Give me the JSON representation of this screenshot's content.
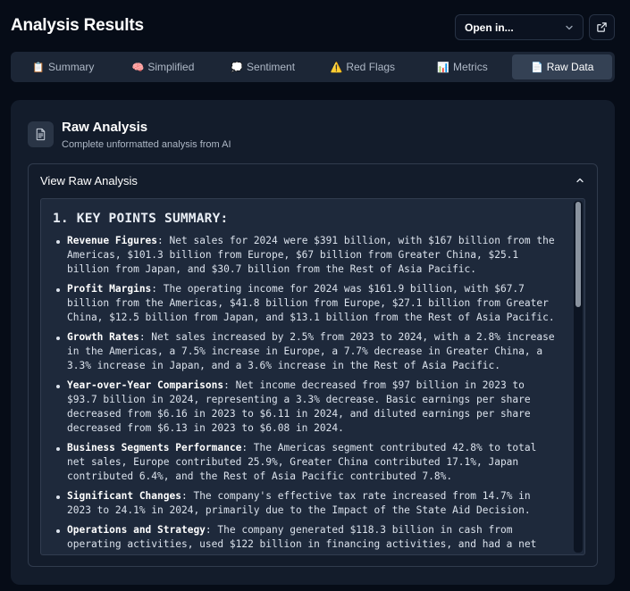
{
  "header": {
    "title": "Analysis Results",
    "open_in_label": "Open in...",
    "open_in_icon": "chevron-down-icon",
    "external_icon": "external-link-icon"
  },
  "tabs": [
    {
      "emoji": "📋",
      "label": "Summary",
      "active": false
    },
    {
      "emoji": "🧠",
      "label": "Simplified",
      "active": false
    },
    {
      "emoji": "💭",
      "label": "Sentiment",
      "active": false
    },
    {
      "emoji": "⚠️",
      "label": "Red Flags",
      "active": false
    },
    {
      "emoji": "📊",
      "label": "Metrics",
      "active": false
    },
    {
      "emoji": "📄",
      "label": "Raw Data",
      "active": true
    }
  ],
  "panel": {
    "icon": "document-icon",
    "title": "Raw Analysis",
    "subtitle": "Complete unformatted analysis from AI"
  },
  "accordion": {
    "label": "View Raw Analysis",
    "expanded": true
  },
  "raw": {
    "heading": "1. KEY POINTS SUMMARY:",
    "items": [
      {
        "term": "Revenue Figures",
        "text": ": Net sales for 2024 were $391 billion, with $167 billion from the Americas, $101.3 billion from Europe, $67 billion from Greater China, $25.1 billion from Japan, and $30.7 billion from the Rest of Asia Pacific."
      },
      {
        "term": "Profit Margins",
        "text": ": The operating income for 2024 was $161.9 billion, with $67.7 billion from the Americas, $41.8 billion from Europe, $27.1 billion from Greater China, $12.5 billion from Japan, and $13.1 billion from the Rest of Asia Pacific."
      },
      {
        "term": "Growth Rates",
        "text": ": Net sales increased by 2.5% from 2023 to 2024, with a 2.8% increase in the Americas, a 7.5% increase in Europe, a 7.7% decrease in Greater China, a 3.3% increase in Japan, and a 3.6% increase in the Rest of Asia Pacific."
      },
      {
        "term": "Year-over-Year Comparisons",
        "text": ": Net income decreased from $97 billion in 2023 to $93.7 billion in 2024, representing a 3.3% decrease. Basic earnings per share decreased from $6.16 in 2023 to $6.11 in 2024, and diluted earnings per share decreased from $6.13 in 2023 to $6.08 in 2024."
      },
      {
        "term": "Business Segments Performance",
        "text": ": The Americas segment contributed 42.8% to total net sales, Europe contributed 25.9%, Greater China contributed 17.1%, Japan contributed 6.4%, and the Rest of Asia Pacific contributed 7.8%."
      },
      {
        "term": "Significant Changes",
        "text": ": The company's effective tax rate increased from 14.7% in 2023 to 24.1% in 2024, primarily due to the Impact of the State Aid Decision."
      },
      {
        "term": "Operations and Strategy",
        "text": ": The company generated $118.3 billion in cash from operating activities, used $122 billion in financing activities, and had a net"
      }
    ]
  }
}
